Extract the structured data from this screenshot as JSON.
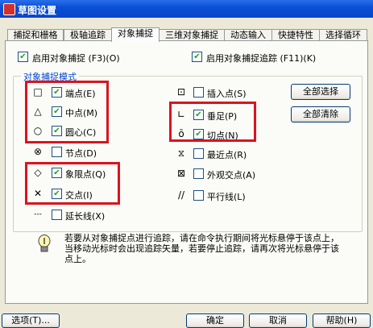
{
  "window": {
    "title": "草图设置"
  },
  "tabs": [
    {
      "label": "捕捉和栅格"
    },
    {
      "label": "极轴追踪"
    },
    {
      "label": "对象捕捉"
    },
    {
      "label": "三维对象捕捉"
    },
    {
      "label": "动态输入"
    },
    {
      "label": "快捷特性"
    },
    {
      "label": "选择循环"
    }
  ],
  "top_options": {
    "snap_on": {
      "label": "启用对象捕捉 (F3)(O)",
      "checked": true
    },
    "tracking_on": {
      "label": "启用对象捕捉追踪 (F11)(K)",
      "checked": true
    }
  },
  "group": {
    "title": "对象捕捉模式",
    "modes": [
      {
        "label": "端点(E)",
        "checked": true,
        "symbol": "□"
      },
      {
        "label": "中点(M)",
        "checked": true,
        "symbol": "△"
      },
      {
        "label": "圆心(C)",
        "checked": true,
        "symbol": "○"
      },
      {
        "label": "节点(D)",
        "checked": false,
        "symbol": "⊗"
      },
      {
        "label": "象限点(Q)",
        "checked": true,
        "symbol": "◇"
      },
      {
        "label": "交点(I)",
        "checked": true,
        "symbol": "✕"
      },
      {
        "label": "延长线(X)",
        "checked": false,
        "symbol": "---"
      },
      {
        "label": "插入点(S)",
        "checked": false,
        "symbol": "⊡"
      },
      {
        "label": "垂足(P)",
        "checked": true,
        "symbol": "∟"
      },
      {
        "label": "切点(N)",
        "checked": true,
        "symbol": "ō"
      },
      {
        "label": "最近点(R)",
        "checked": false,
        "symbol": "⧖"
      },
      {
        "label": "外观交点(A)",
        "checked": false,
        "symbol": "⊠"
      },
      {
        "label": "平行线(L)",
        "checked": false,
        "symbol": "//"
      }
    ],
    "select_all": "全部选择",
    "clear_all": "全部清除"
  },
  "info": {
    "text": "若要从对象捕捉点进行追踪，请在命令执行期间将光标悬停于该点上，当移动光标时会出现追踪矢量，若要停止追踪，请再次将光标悬停于该点上。"
  },
  "footer": {
    "options": "选项(T)...",
    "ok": "确定",
    "cancel": "取消",
    "help": "帮助(H)"
  },
  "colors": {
    "highlight": "#d8151d",
    "check": "#21a121",
    "title_bar": "#0a4fd8"
  }
}
